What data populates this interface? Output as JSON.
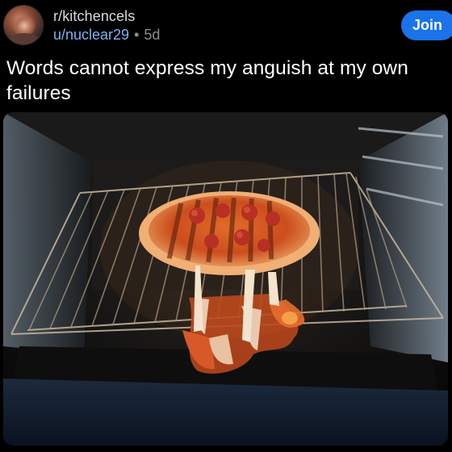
{
  "post": {
    "subreddit": "r/kitchencels",
    "author": "u/nuclear29",
    "separator": "•",
    "age": "5d",
    "join_label": "Join",
    "title": "Words cannot express my anguish at my own failures"
  },
  "image": {
    "subject": "collapsed pizza drooping through oven rack",
    "icon": "photo"
  },
  "colors": {
    "background": "#000000",
    "join_button": "#1a73e8",
    "author_link": "#7fb2f0",
    "muted_text": "#8a8d90"
  }
}
